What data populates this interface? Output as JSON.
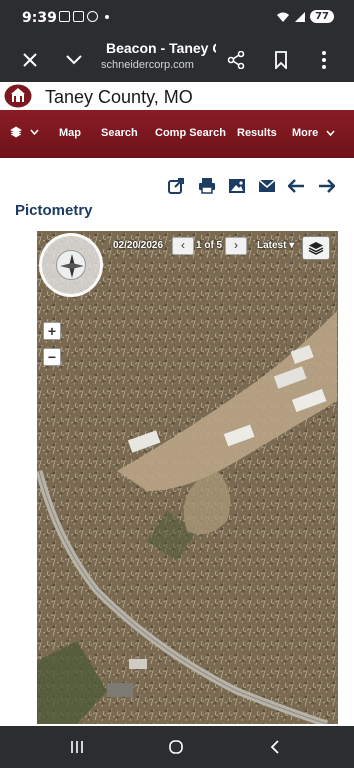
{
  "status_bar": {
    "time": "9:39",
    "battery": "77"
  },
  "browser": {
    "title": "Beacon - Taney County, MO",
    "url": "schneidercorp.com"
  },
  "site": {
    "county": "Taney County, MO"
  },
  "nav": {
    "items": [
      "Map",
      "Search",
      "Comp Search",
      "Results",
      "More"
    ]
  },
  "section": {
    "title": "Pictometry"
  },
  "map": {
    "date": "02/20/2026",
    "pager": "1 of 5",
    "view_select": "Latest",
    "zoom_in": "+",
    "zoom_out": "−",
    "prev": "‹",
    "next": "›"
  },
  "icons": {
    "toolbar": [
      "share-icon",
      "print-icon",
      "image-icon",
      "email-icon",
      "arrow-left-icon",
      "arrow-right-icon"
    ],
    "accent": "#7e1820",
    "title_color": "#1c3c63"
  }
}
